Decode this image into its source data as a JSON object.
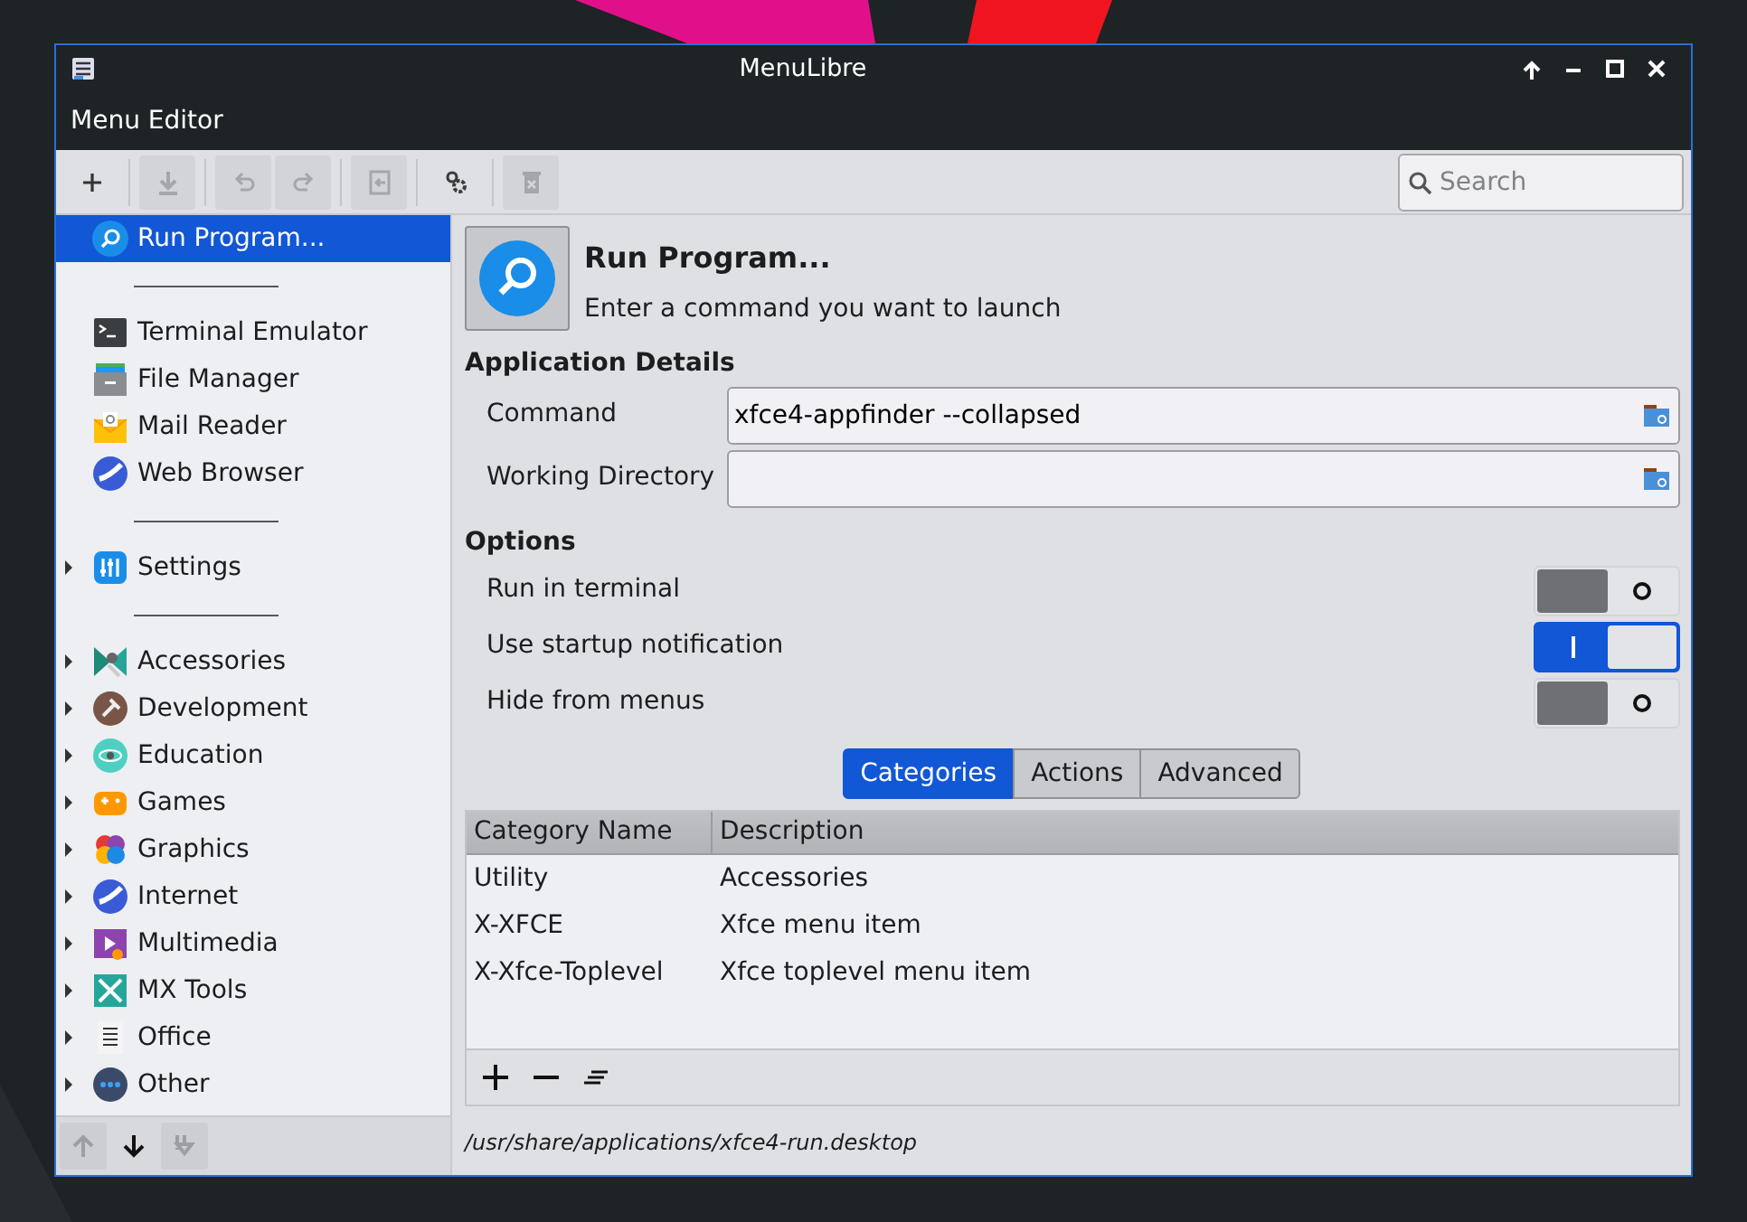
{
  "window": {
    "title": "MenuLibre"
  },
  "menubar": [
    "Menu Editor"
  ],
  "toolbar": [
    {
      "kind": "add",
      "disabled": false
    },
    {
      "kind": "save",
      "disabled": true
    },
    {
      "kind": "undo",
      "disabled": true
    },
    {
      "kind": "redo",
      "disabled": true
    },
    {
      "kind": "revert",
      "disabled": true
    },
    {
      "kind": "settings",
      "disabled": false
    },
    {
      "kind": "delete",
      "disabled": true
    }
  ],
  "search": {
    "placeholder": "Search"
  },
  "sidebar": {
    "items": [
      {
        "kind": "item",
        "label": "Run Program...",
        "selected": true,
        "expandable": false
      },
      {
        "kind": "separator"
      },
      {
        "kind": "item",
        "label": "Terminal Emulator",
        "selected": false,
        "expandable": false
      },
      {
        "kind": "item",
        "label": "File Manager",
        "selected": false,
        "expandable": false
      },
      {
        "kind": "item",
        "label": "Mail Reader",
        "selected": false,
        "expandable": false
      },
      {
        "kind": "item",
        "label": "Web Browser",
        "selected": false,
        "expandable": false
      },
      {
        "kind": "separator"
      },
      {
        "kind": "item",
        "label": "Settings",
        "selected": false,
        "expandable": true
      },
      {
        "kind": "separator"
      },
      {
        "kind": "item",
        "label": "Accessories",
        "selected": false,
        "expandable": true
      },
      {
        "kind": "item",
        "label": "Development",
        "selected": false,
        "expandable": true
      },
      {
        "kind": "item",
        "label": "Education",
        "selected": false,
        "expandable": true
      },
      {
        "kind": "item",
        "label": "Games",
        "selected": false,
        "expandable": true
      },
      {
        "kind": "item",
        "label": "Graphics",
        "selected": false,
        "expandable": true
      },
      {
        "kind": "item",
        "label": "Internet",
        "selected": false,
        "expandable": true
      },
      {
        "kind": "item",
        "label": "Multimedia",
        "selected": false,
        "expandable": true
      },
      {
        "kind": "item",
        "label": "MX Tools",
        "selected": false,
        "expandable": true
      },
      {
        "kind": "item",
        "label": "Office",
        "selected": false,
        "expandable": true
      },
      {
        "kind": "item",
        "label": "Other",
        "selected": false,
        "expandable": true
      }
    ],
    "bottom_buttons": [
      {
        "kind": "up",
        "disabled": true
      },
      {
        "kind": "down",
        "disabled": false
      },
      {
        "kind": "sort",
        "disabled": true
      }
    ]
  },
  "header": {
    "title": "Run Program...",
    "comment": "Enter a command you want to launch"
  },
  "application_details": {
    "heading": "Application Details",
    "fields": [
      {
        "label": "Command",
        "value": "xfce4-appfinder --collapsed"
      },
      {
        "label": "Working Directory"
      }
    ]
  },
  "options": {
    "heading": "Options",
    "switches": [
      {
        "label": "Run in terminal",
        "on": false
      },
      {
        "label": "Use startup notification",
        "on": true
      },
      {
        "label": "Hide from menus",
        "on": false
      }
    ]
  },
  "tabs": [
    {
      "label": "Categories",
      "selected": true
    },
    {
      "label": "Actions",
      "selected": false
    },
    {
      "label": "Advanced",
      "selected": false
    }
  ],
  "table": {
    "columns": [
      "Category Name",
      "Description"
    ],
    "rows": [
      [
        "Utility",
        "Accessories"
      ],
      [
        "X-XFCE",
        "Xfce menu item"
      ],
      [
        "X-Xfce-Toplevel",
        "Xfce toplevel menu item"
      ]
    ],
    "buttons": [
      {
        "kind": "add"
      },
      {
        "kind": "remove"
      },
      {
        "kind": "clear"
      }
    ]
  },
  "status_bar": "/usr/share/applications/xfce4-run.desktop"
}
